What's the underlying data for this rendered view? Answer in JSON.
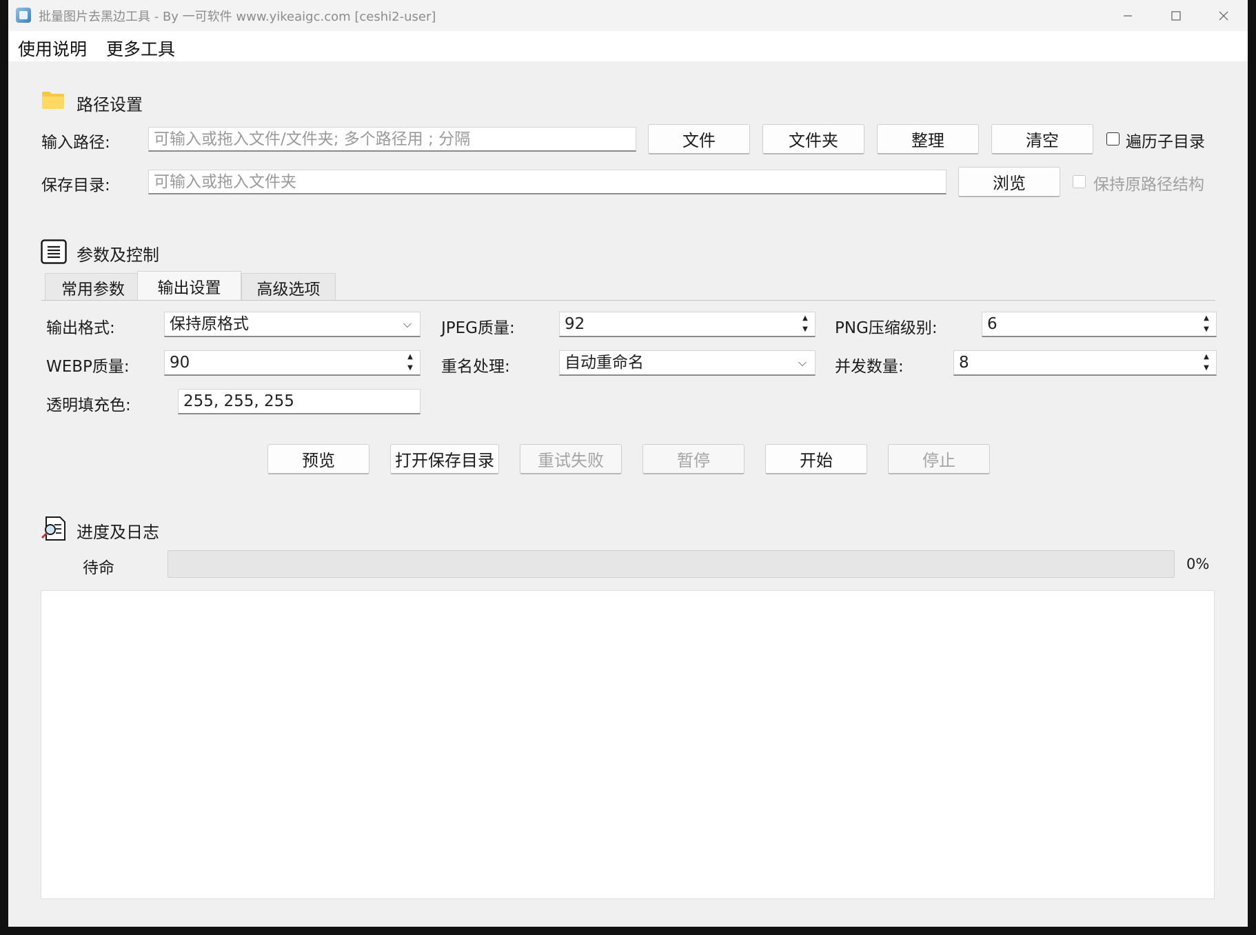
{
  "window": {
    "title": "批量图片去黑边工具 - By 一可软件 www.yikeaigc.com  [ceshi2-user]"
  },
  "menu": {
    "items": [
      "使用说明",
      "更多工具"
    ]
  },
  "path_section": {
    "title": "路径设置",
    "input_label": "输入路径:",
    "input_placeholder": "可输入或拖入文件/文件夹; 多个路径用 ; 分隔",
    "buttons": {
      "file": "文件",
      "folder": "文件夹",
      "organize": "整理",
      "clear": "清空",
      "browse": "浏览"
    },
    "recurse_label": "遍历子目录",
    "save_label": "保存目录:",
    "save_placeholder": "可输入或拖入文件夹",
    "keep_structure_label": "保持原路径结构"
  },
  "params_section": {
    "title": "参数及控制",
    "tabs": [
      "常用参数",
      "输出设置",
      "高级选项"
    ],
    "active_tab": "输出设置",
    "fields": {
      "output_format_label": "输出格式:",
      "output_format_value": "保持原格式",
      "jpeg_quality_label": "JPEG质量:",
      "jpeg_quality_value": "92",
      "png_level_label": "PNG压缩级别:",
      "png_level_value": "6",
      "webp_quality_label": "WEBP质量:",
      "webp_quality_value": "90",
      "rename_label": "重名处理:",
      "rename_value": "自动重命名",
      "concurrency_label": "并发数量:",
      "concurrency_value": "8",
      "fill_color_label": "透明填充色:",
      "fill_color_value": "255, 255, 255"
    },
    "actions": {
      "preview": "预览",
      "open_save_dir": "打开保存目录",
      "retry_failed": "重试失败",
      "pause": "暂停",
      "start": "开始",
      "stop": "停止"
    }
  },
  "progress_section": {
    "title": "进度及日志",
    "status": "待命",
    "percent_text": "0%",
    "progress_fraction": 0
  }
}
